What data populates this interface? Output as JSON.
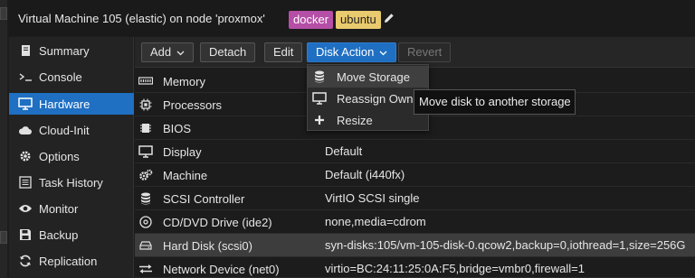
{
  "header": {
    "title": "Virtual Machine 105 (elastic) on node 'proxmox'",
    "tags": [
      "docker",
      "ubuntu"
    ],
    "tag_colors": {
      "docker": "#b54ea6",
      "ubuntu": "#e9ca6e"
    },
    "edit_icon": "pencil-icon"
  },
  "sidebar": {
    "items": [
      {
        "label": "Summary",
        "icon": "book-icon"
      },
      {
        "label": "Console",
        "icon": "terminal-icon"
      },
      {
        "label": "Hardware",
        "icon": "monitor-icon",
        "active": true
      },
      {
        "label": "Cloud-Init",
        "icon": "cloud-icon"
      },
      {
        "label": "Options",
        "icon": "gear-icon"
      },
      {
        "label": "Task History",
        "icon": "list-icon"
      },
      {
        "label": "Monitor",
        "icon": "eye-icon"
      },
      {
        "label": "Backup",
        "icon": "floppy-icon"
      },
      {
        "label": "Replication",
        "icon": "sync-icon"
      }
    ],
    "active_color": "#1f6fc2"
  },
  "toolbar": {
    "add_label": "Add",
    "detach_label": "Detach",
    "edit_label": "Edit",
    "disk_action_label": "Disk Action",
    "revert_label": "Revert"
  },
  "hardware": {
    "rows": [
      {
        "key": "Memory",
        "value": "",
        "icon": "memory-icon"
      },
      {
        "key": "Processors",
        "value": "",
        "icon": "cpu-icon"
      },
      {
        "key": "BIOS",
        "value": "",
        "icon": "chip-icon"
      },
      {
        "key": "Display",
        "value": "Default",
        "icon": "desktop-icon"
      },
      {
        "key": "Machine",
        "value": "Default (i440fx)",
        "icon": "cogs-icon"
      },
      {
        "key": "SCSI Controller",
        "value": "VirtIO SCSI single",
        "icon": "database-icon"
      },
      {
        "key": "CD/DVD Drive (ide2)",
        "value": "none,media=cdrom",
        "icon": "cdrom-icon"
      },
      {
        "key": "Hard Disk (scsi0)",
        "value": "syn-disks:105/vm-105-disk-0.qcow2,backup=0,iothread=1,size=256G",
        "icon": "hdd-icon",
        "selected": true
      },
      {
        "key": "Network Device (net0)",
        "value": "virtio=BC:24:11:25:0A:F5,bridge=vmbr0,firewall=1",
        "icon": "exchange-icon"
      }
    ]
  },
  "disk_menu": {
    "items": [
      {
        "label": "Move Storage",
        "icon": "database-icon"
      },
      {
        "label": "Reassign Owner",
        "icon": "desktop-icon"
      },
      {
        "label": "Resize",
        "icon": "plus-icon"
      }
    ]
  },
  "tooltip": {
    "text": "Move disk to another storage"
  }
}
